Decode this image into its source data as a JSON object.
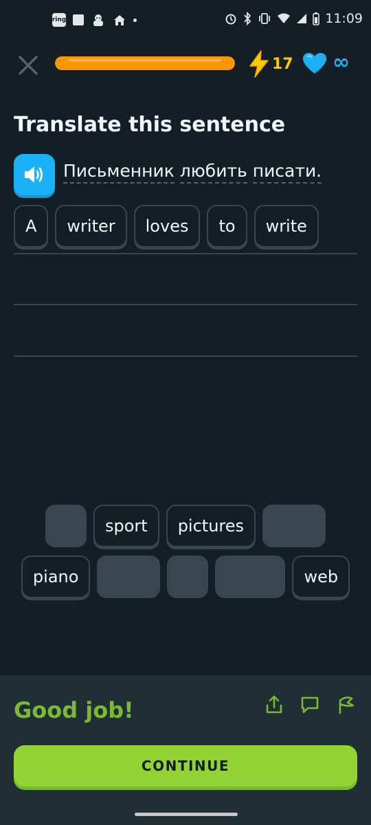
{
  "status_bar": {
    "time": "11:09",
    "ring_label": "ring",
    "icons": [
      "ring-icon",
      "square-icon",
      "dog-icon",
      "home-icon",
      "dot-icon",
      "alarm-icon",
      "bluetooth-icon",
      "vibrate-icon",
      "wifi-icon",
      "signal-icon",
      "battery-icon"
    ]
  },
  "header": {
    "progress_percent": 100,
    "streak_count": "17",
    "hearts": "∞",
    "colors": {
      "progress": "#ff9600",
      "streak": "#ffc800",
      "heart": "#1cb0f6"
    }
  },
  "exercise": {
    "title": "Translate this sentence",
    "prompt_words": [
      "Письменник",
      "любить",
      "писати."
    ]
  },
  "answer": {
    "words": [
      "A",
      "writer",
      "loves",
      "to",
      "write"
    ]
  },
  "word_bank": {
    "row1": [
      {
        "label": "",
        "used": true
      },
      {
        "label": "sport",
        "used": false
      },
      {
        "label": "pictures",
        "used": false
      },
      {
        "label": "",
        "used": true
      }
    ],
    "row2": [
      {
        "label": "piano",
        "used": false
      },
      {
        "label": "",
        "used": true
      },
      {
        "label": "",
        "used": true
      },
      {
        "label": "",
        "used": true
      },
      {
        "label": "web",
        "used": false
      }
    ]
  },
  "feedback": {
    "message": "Good job!",
    "continue_label": "CONTINUE",
    "icons": [
      "share-icon",
      "comment-icon",
      "flag-icon"
    ],
    "colors": {
      "message": "#79b933",
      "button": "#93d333"
    }
  }
}
